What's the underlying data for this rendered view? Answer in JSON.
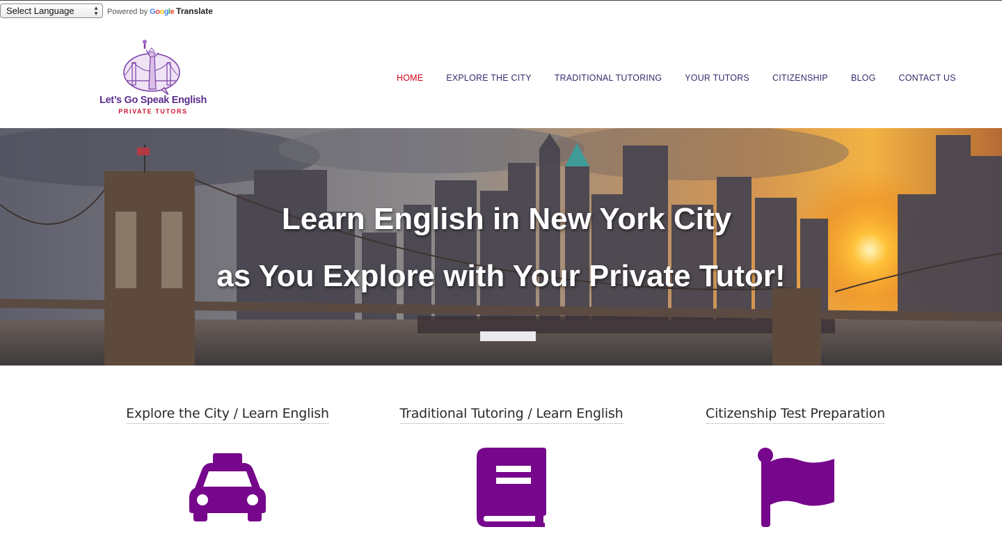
{
  "translate": {
    "select_label": "Select Language",
    "powered_by": "Powered by",
    "google": "Google",
    "translate": "Translate"
  },
  "logo": {
    "title": "Let’s Go Speak English",
    "subtitle": "PRIVATE TUTORS"
  },
  "nav": {
    "items": [
      {
        "label": "HOME",
        "active": true
      },
      {
        "label": "EXPLORE THE CITY"
      },
      {
        "label": "TRADITIONAL TUTORING"
      },
      {
        "label": "YOUR TUTORS"
      },
      {
        "label": "CITIZENSHIP"
      },
      {
        "label": "BLOG"
      },
      {
        "label": "CONTACT US"
      }
    ]
  },
  "hero": {
    "line1": "Learn English in New York City",
    "line2": "as You Explore with Your Private Tutor!"
  },
  "services": [
    {
      "title": "Explore the City / Learn English",
      "icon": "taxi-icon"
    },
    {
      "title": "Traditional Tutoring / Learn English",
      "icon": "book-icon"
    },
    {
      "title": "Citizenship Test Preparation",
      "icon": "flag-icon"
    }
  ],
  "colors": {
    "brand_purple": "#76068b",
    "nav_active": "#d0021b",
    "nav_text": "#3a2a6e"
  }
}
